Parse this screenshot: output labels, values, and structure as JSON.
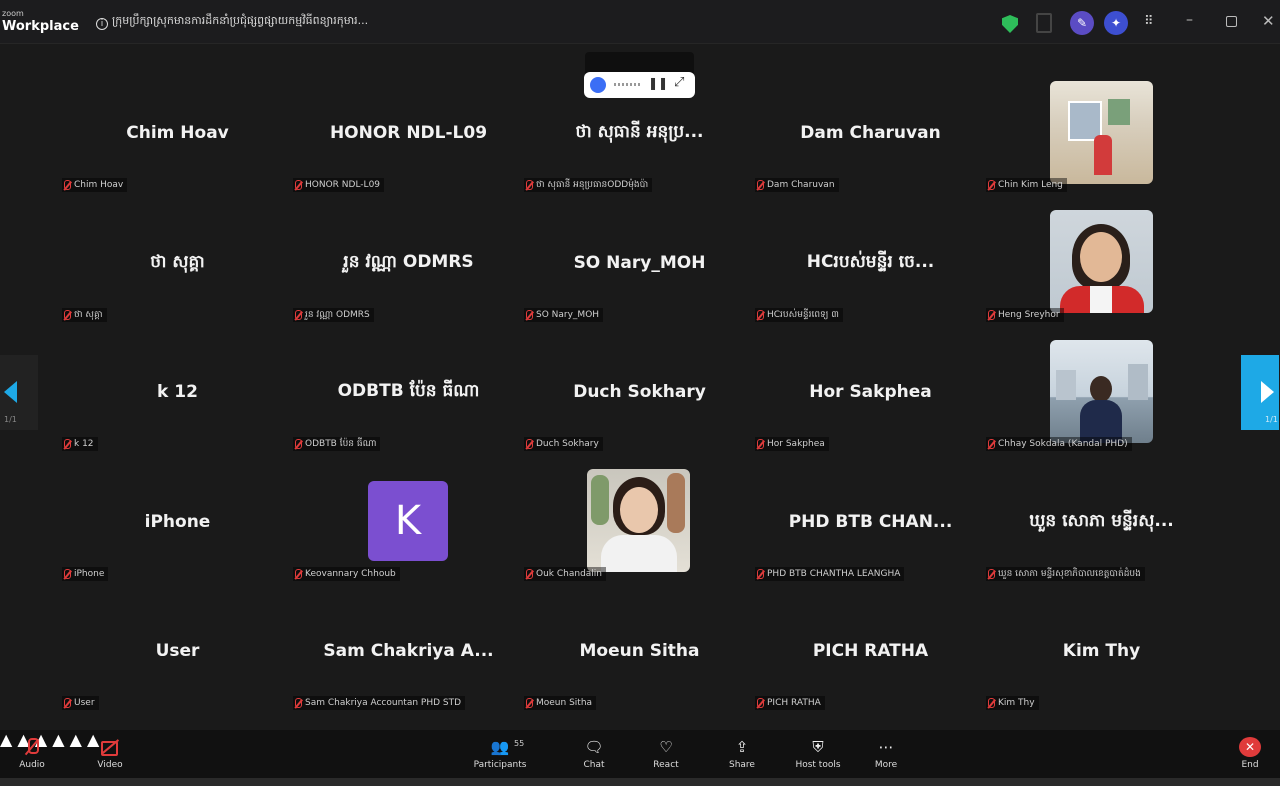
{
  "app": {
    "logo_line1": "zoom",
    "logo_line2": "Workplace",
    "meeting_title": "ក្រុមប្រឹក្សាស្រុកមានការដឹកនាំប្រជុំផ្សព្វផ្សាយកម្មវិធីពន្យារកុមារ..."
  },
  "window_controls": {
    "minimize": "–",
    "close": "✕"
  },
  "tiles": [
    {
      "name": "Chim Hoav",
      "label": "Chim Hoav"
    },
    {
      "name": "HONOR NDL-L09",
      "label": "HONOR NDL-L09"
    },
    {
      "name": "ថា សុធានី អនុប្រ...",
      "label": "ថា សុធានី អនុប្រធានODDម៉ុងប៉ា"
    },
    {
      "name": "Dam Charuvan",
      "label": "Dam Charuvan"
    },
    {
      "name": "",
      "label": "Chin Kim Leng"
    },
    {
      "name": "ថា សុគ្គា",
      "label": "ថា សុគ្គា"
    },
    {
      "name": "រួន វណ្ណា ODMRS",
      "label": "រួន វណ្ណា ODMRS"
    },
    {
      "name": "SO Nary_MOH",
      "label": "SO Nary_MOH"
    },
    {
      "name": "HCរបស់មន្ទីរ ចេ...",
      "label": "HCរបស់មន្ទីរពេទ្យ ៣"
    },
    {
      "name": "",
      "label": "Heng Sreyhor"
    },
    {
      "name": "k 12",
      "label": "k 12"
    },
    {
      "name": "ODBTB ប៉ែន ធីណា",
      "label": "ODBTB ប៉ែន ធីណា"
    },
    {
      "name": "Duch Sokhary",
      "label": "Duch Sokhary"
    },
    {
      "name": "Hor Sakphea",
      "label": "Hor Sakphea"
    },
    {
      "name": "",
      "label": "Chhay Sokdala (Kandal PHD)"
    },
    {
      "name": "iPhone",
      "label": "iPhone"
    },
    {
      "name": "",
      "label": "Keovannary Chhoub",
      "avatar_letter": "K"
    },
    {
      "name": "",
      "label": "Ouk Chandalin"
    },
    {
      "name": "PHD BTB CHAN...",
      "label": "PHD BTB CHANTHA LEANGHA"
    },
    {
      "name": "ឃួន សោភា មន្ទីរសុ...",
      "label": "ឃួន សោភា មន្ទីរសុខាភិបាលខេត្តបាត់ដំបង"
    },
    {
      "name": "User",
      "label": "User"
    },
    {
      "name": "Sam Chakriya A...",
      "label": "Sam Chakriya Accountan PHD STD"
    },
    {
      "name": "Moeun Sitha",
      "label": "Moeun Sitha"
    },
    {
      "name": "PICH RATHA",
      "label": "PICH RATHA"
    },
    {
      "name": "Kim Thy",
      "label": "Kim Thy"
    }
  ],
  "pagination": {
    "left": "1/1",
    "right": "1/1"
  },
  "toolbar": {
    "audio": "Audio",
    "video": "Video",
    "participants": "Participants",
    "participants_count": "55",
    "chat": "Chat",
    "react": "React",
    "share": "Share",
    "host_tools": "Host tools",
    "more": "More",
    "end": "End"
  },
  "colors": {
    "accent": "#1ea9e6",
    "muted": "#e03b3b",
    "avatar_k": "#7b4fd0"
  }
}
